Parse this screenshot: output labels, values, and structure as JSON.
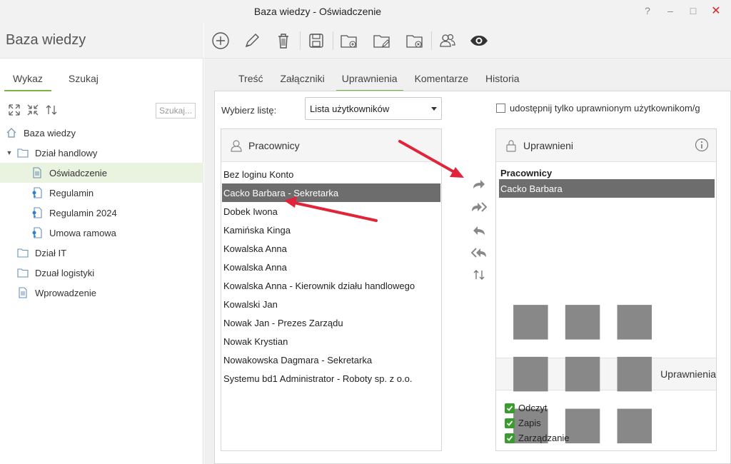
{
  "window": {
    "title": "Baza wiedzy - Oświadczenie",
    "help": "?",
    "minimize": "–",
    "maximize": "□",
    "close": "✕"
  },
  "app": {
    "title": "Baza wiedzy"
  },
  "toolbar": {
    "icons": [
      "add-icon",
      "edit-icon",
      "delete-icon",
      "save-icon",
      "new-folder-icon",
      "edit-folder-icon",
      "delete-folder-icon",
      "users-icon",
      "preview-icon"
    ]
  },
  "left": {
    "tabs": [
      "Wykaz",
      "Szukaj"
    ],
    "search_placeholder": "Szukaj...",
    "tree": [
      {
        "label": "Baza wiedzy",
        "icon": "home-icon"
      },
      {
        "label": "Dział handlowy",
        "icon": "folder-icon"
      },
      {
        "label": "Oświadczenie",
        "icon": "document-icon"
      },
      {
        "label": "Regulamin",
        "icon": "document-key-icon"
      },
      {
        "label": "Regulamin 2024",
        "icon": "document-key-icon"
      },
      {
        "label": "Umowa ramowa",
        "icon": "document-key-icon"
      },
      {
        "label": "Dział IT",
        "icon": "folder-icon"
      },
      {
        "label": "Dzuał logistyki",
        "icon": "folder-icon"
      },
      {
        "label": "Wprowadzenie",
        "icon": "document-icon"
      }
    ]
  },
  "tabs": [
    "Treść",
    "Załączniki",
    "Uprawnienia",
    "Komentarze",
    "Historia"
  ],
  "form": {
    "choose_list_label": "Wybierz listę:",
    "list_value": "Lista użytkowników",
    "share_label": "udostępnij tylko uprawnionym użytkownikom/g"
  },
  "employees": {
    "title": "Pracownicy",
    "items": [
      "Bez loginu Konto",
      "Cacko Barbara - Sekretarka",
      "Dobek Iwona",
      "Kamińska Kinga",
      "Kowalska Anna",
      "Kowalska Anna",
      "Kowalska Anna - Kierownik działu handlowego",
      "Kowalski Jan",
      "Nowak Jan - Prezes Zarządu",
      "Nowak Krystian",
      "Nowakowska Dagmara - Sekretarka",
      "Systemu bd1 Administrator - Roboty sp. z o.o."
    ]
  },
  "authorized": {
    "title": "Uprawnieni",
    "group": "Pracownicy",
    "item": "Cacko Barbara"
  },
  "permissions": {
    "title": "Uprawnienia",
    "items": [
      "Odczyt",
      "Zapis",
      "Zarządzanie"
    ]
  },
  "colors": {
    "accent": "#7cb342",
    "selection": "#6d6d6d",
    "check": "#3a9b2f",
    "annotation": "#e0243a"
  }
}
